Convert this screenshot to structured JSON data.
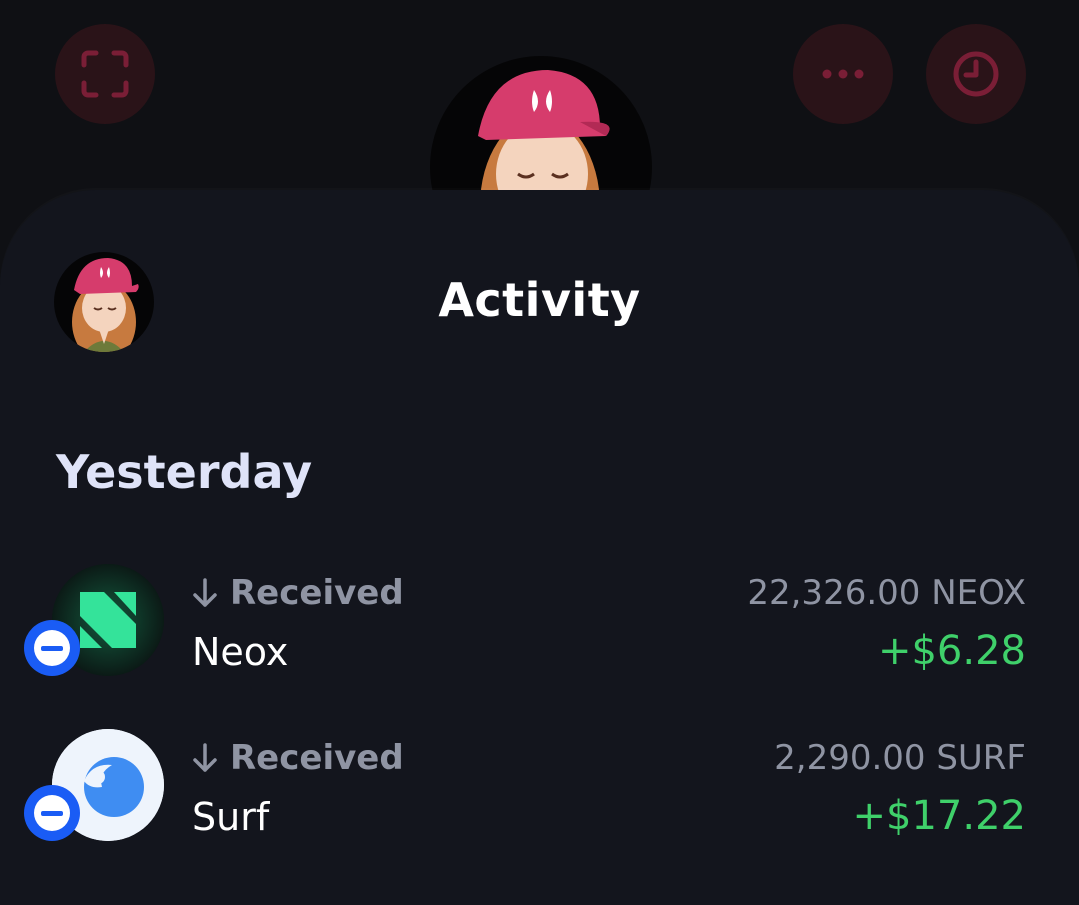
{
  "header": {
    "scan_icon": "scan-icon",
    "more_icon": "more-horizontal-icon",
    "history_icon": "clock-icon",
    "button_color": "#2a1318",
    "icon_color": "#7a1e36"
  },
  "sheet": {
    "title": "Activity"
  },
  "activity": {
    "section_label": "Yesterday",
    "items": [
      {
        "type_label": "Received",
        "token_name": "Neox",
        "amount": "22,326.00 NEOX",
        "usd_value": "+$6.28",
        "icon": "neox-token-icon"
      },
      {
        "type_label": "Received",
        "token_name": "Surf",
        "amount": "2,290.00 SURF",
        "usd_value": "+$17.22",
        "icon": "surf-token-icon"
      }
    ]
  },
  "colors": {
    "positive": "#3fd06a",
    "badge": "#1a5cf5",
    "muted_text": "#8f94a3",
    "sheet_bg": "#13151d"
  }
}
